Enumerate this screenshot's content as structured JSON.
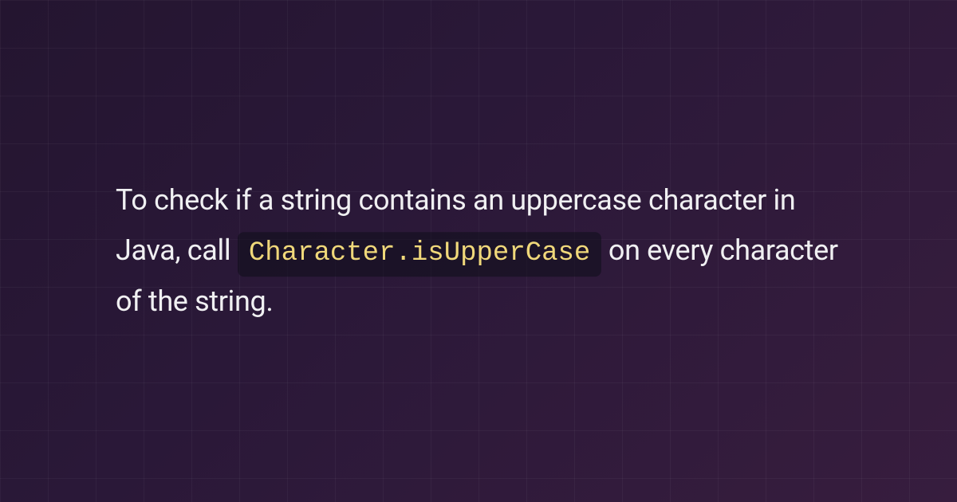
{
  "content": {
    "text_before": "To check if a string contains an uppercase character in Java, call ",
    "code": "Character.isUpperCase",
    "text_after": " on every character of the string."
  }
}
